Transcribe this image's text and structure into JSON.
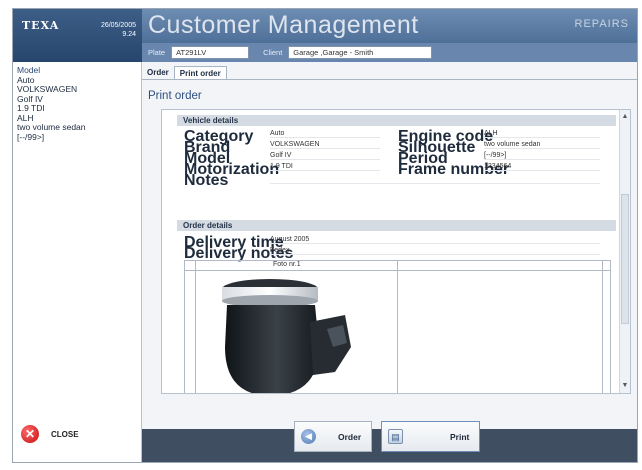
{
  "brand": {
    "logo": "TEXA",
    "date": "26/05/2005",
    "time": "9.24"
  },
  "header": {
    "title": "Customer Management",
    "section": "REPAIRS"
  },
  "fields": {
    "plate_label": "Plate",
    "plate_value": "AT291LV",
    "client_label": "Client",
    "client_value": "Garage ,Garage - Smith"
  },
  "sidebar": {
    "lines": [
      "Model",
      "Auto",
      "VOLKSWAGEN",
      "Golf IV",
      "1.9 TDI",
      "ALH",
      "two volume sedan",
      "[--/99>]"
    ],
    "close_label": "CLOSE"
  },
  "tabs": [
    {
      "label": "Order"
    },
    {
      "label": "Print order"
    }
  ],
  "page_title": "Print order",
  "vehicle": {
    "heading": "Vehicle details",
    "category_label": "Category",
    "category_value": "Auto",
    "brand_label": "Brand",
    "brand_value": "VOLKSWAGEN",
    "model_label": "Model",
    "model_value": "Golf IV",
    "motorization_label": "Motorization",
    "motorization_value": "1.9 TDI",
    "notes_label": "Notes",
    "notes_value": "",
    "engine_label": "Engine code",
    "engine_value": "ALH",
    "silhouette_label": "Silhouette",
    "silhouette_value": "two volume sedan",
    "period_label": "Period",
    "period_value": "[--/99>]",
    "frame_label": "Frame number",
    "frame_value": "1234564"
  },
  "order": {
    "heading": "Order details",
    "delivery_time_label": "Delivery time",
    "delivery_time_value": "August 2005",
    "delivery_notes_label": "Delivery notes",
    "delivery_notes_value": "Fedex",
    "photo_label": "Foto nr.1"
  },
  "buttons": {
    "order_label": "Order",
    "print_label": "Print"
  },
  "colors": {
    "header": "#5d7ea7",
    "brand": "#2f4f79",
    "bottom_bar": "#3f4e61",
    "close": "#d01f22"
  }
}
